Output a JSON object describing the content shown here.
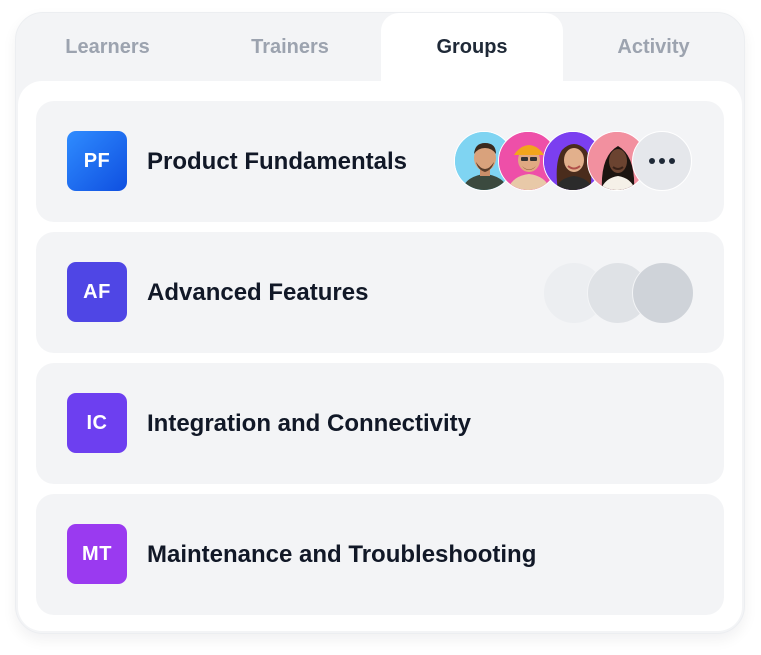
{
  "tabs": [
    {
      "label": "Learners"
    },
    {
      "label": "Trainers"
    },
    {
      "label": "Groups"
    },
    {
      "label": "Activity"
    }
  ],
  "active_tab": "Groups",
  "groups": [
    {
      "initials": "PF",
      "name": "Product Fundamentals",
      "badge_color": "#1d6cf0",
      "members": "avatars-with-more"
    },
    {
      "initials": "AF",
      "name": "Advanced Features",
      "badge_color": "#4f46e5",
      "members": "empty-placeholders"
    },
    {
      "initials": "IC",
      "name": "Integration and Connectivity",
      "badge_color": "#6d3ff0"
    },
    {
      "initials": "MT",
      "name": "Maintenance and Troubleshooting",
      "badge_color": "#9a3af0"
    }
  ],
  "icons": {
    "more": "more-horizontal-icon"
  }
}
